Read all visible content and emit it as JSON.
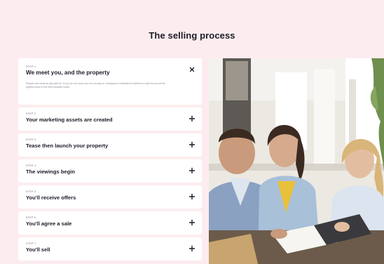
{
  "page": {
    "title": "The selling process"
  },
  "accordion": {
    "items": [
      {
        "step": "STEP 1",
        "title": "We meet you, and the property",
        "description": "Results are what we get paid for. If you do not move you do not pay us. Keeping us motivated to achieve a sale for you at the highest price to the best possible buyer.",
        "state": "open",
        "toggle_icon": "close-icon"
      },
      {
        "step": "STEP 2",
        "title": "Your marketing assets are created",
        "state": "closed",
        "toggle_icon": "plus-icon"
      },
      {
        "step": "STEP 3",
        "title": "Tease then launch your property",
        "state": "closed",
        "toggle_icon": "plus-icon"
      },
      {
        "step": "STEP 4",
        "title": "The viewings begin",
        "state": "closed",
        "toggle_icon": "plus-icon"
      },
      {
        "step": "STEP 5",
        "title": "You'll receive offers",
        "state": "closed",
        "toggle_icon": "plus-icon"
      },
      {
        "step": "STEP 6",
        "title": "You'll agree a sale",
        "state": "closed",
        "toggle_icon": "plus-icon"
      },
      {
        "step": "STEP 7",
        "title": "You'll sell",
        "state": "closed",
        "toggle_icon": "plus-icon"
      }
    ]
  },
  "colors": {
    "background": "#fdecef",
    "card": "#ffffff",
    "text": "#1c1c28"
  },
  "photo": {
    "subject": "three people reviewing documents at a table in a bright room"
  }
}
